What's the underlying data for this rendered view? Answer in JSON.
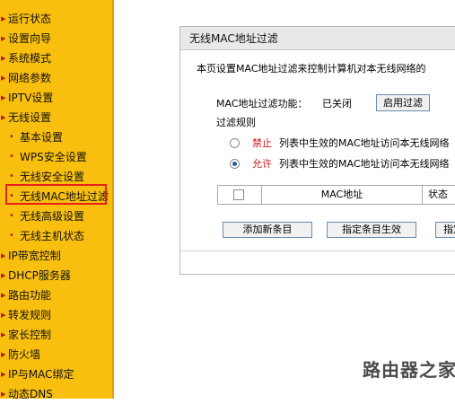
{
  "sidebar": {
    "items": [
      {
        "label": "运行状态",
        "sub": false
      },
      {
        "label": "设置向导",
        "sub": false
      },
      {
        "label": "系统模式",
        "sub": false
      },
      {
        "label": "网络参数",
        "sub": false
      },
      {
        "label": "IPTV设置",
        "sub": false
      },
      {
        "label": "无线设置",
        "sub": false
      },
      {
        "label": "基本设置",
        "sub": true
      },
      {
        "label": "WPS安全设置",
        "sub": true
      },
      {
        "label": "无线安全设置",
        "sub": true
      },
      {
        "label": "无线MAC地址过滤",
        "sub": true,
        "selected": true
      },
      {
        "label": "无线高级设置",
        "sub": true
      },
      {
        "label": "无线主机状态",
        "sub": true
      },
      {
        "label": "IP带宽控制",
        "sub": false
      },
      {
        "label": "DHCP服务器",
        "sub": false
      },
      {
        "label": "路由功能",
        "sub": false
      },
      {
        "label": "转发规则",
        "sub": false
      },
      {
        "label": "家长控制",
        "sub": false
      },
      {
        "label": "防火墙",
        "sub": false
      },
      {
        "label": "IP与MAC绑定",
        "sub": false
      },
      {
        "label": "动态DNS",
        "sub": false
      }
    ]
  },
  "panel": {
    "title": "无线MAC地址过滤",
    "description": "本页设置MAC地址过滤来控制计算机对本无线网络的",
    "function_label": "MAC地址过滤功能：",
    "function_status": "已关闭",
    "enable_button": "启用过滤",
    "rules_label": "过滤规则",
    "deny_word": "禁止",
    "deny_text": "列表中生效的MAC地址访问本无线网络",
    "allow_word": "允许",
    "allow_text": "列表中生效的MAC地址访问本无线网络",
    "selected_rule": "allow",
    "table_headers": {
      "mac": "MAC地址",
      "status": "状态"
    },
    "buttons": {
      "add": "添加新条目",
      "apply": "指定条目生效",
      "next": "指定"
    }
  },
  "watermark": "路由器之家",
  "colors": {
    "sidebar": "#f9bf0f",
    "highlight_box": "#e8201a",
    "accent_text": "#c81e1e"
  }
}
